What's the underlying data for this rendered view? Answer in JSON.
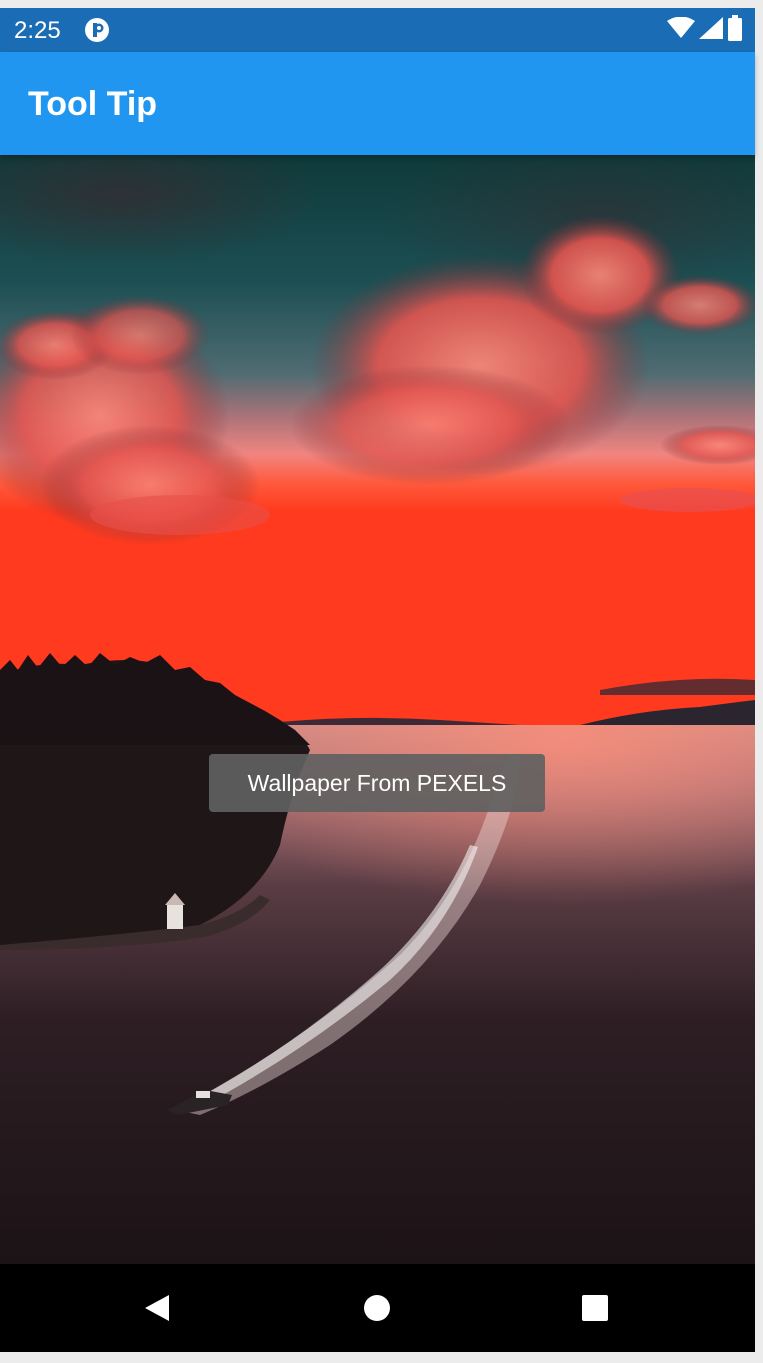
{
  "status_bar": {
    "time": "2:25",
    "app_icon": "app-notification-icon",
    "icons": [
      "wifi-icon",
      "cell-signal-icon",
      "battery-icon"
    ]
  },
  "app_bar": {
    "title": "Tool Tip",
    "color": "#2196f0"
  },
  "content": {
    "image_label": "wallpaper-image"
  },
  "tooltip": {
    "text": "Wallpaper From PEXELS"
  },
  "nav_bar": {
    "buttons": [
      "back-icon",
      "home-icon",
      "recents-icon"
    ]
  },
  "colors": {
    "status_bar": "#1a6db5",
    "app_bar": "#2196f0",
    "tooltip_bg": "#616161"
  }
}
